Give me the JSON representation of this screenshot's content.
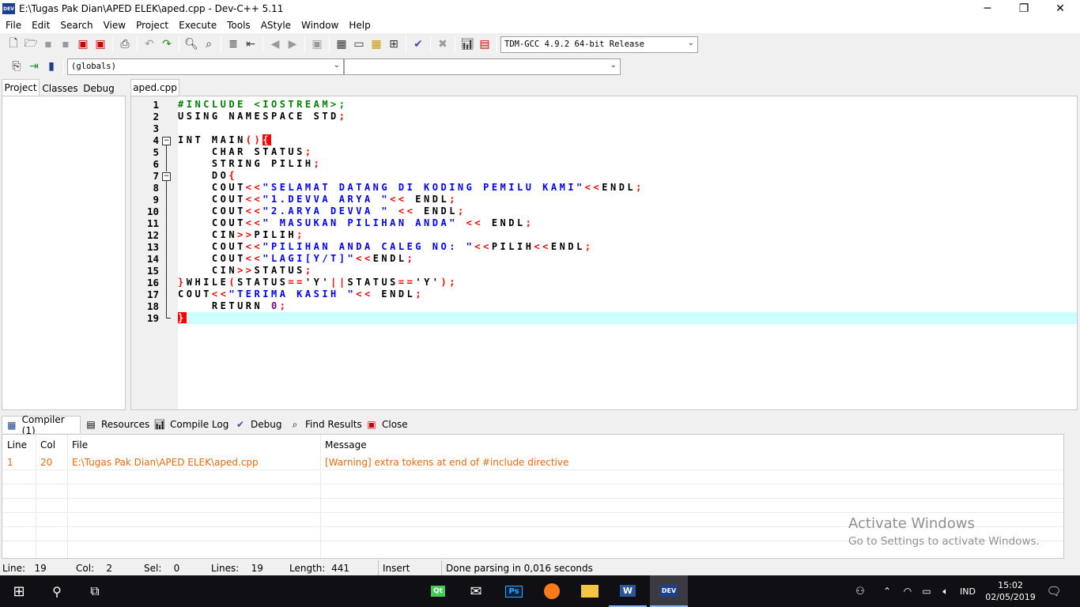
{
  "window": {
    "title": "E:\\Tugas Pak Dian\\APED ELEK\\aped.cpp - Dev-C++ 5.11",
    "app_icon_text": "DEV"
  },
  "menu": [
    "File",
    "Edit",
    "Search",
    "View",
    "Project",
    "Execute",
    "Tools",
    "AStyle",
    "Window",
    "Help"
  ],
  "toolbar": {
    "compiler_select": "TDM-GCC 4.9.2 64-bit Release",
    "scope_select": "(globals)",
    "function_select": ""
  },
  "left_tabs": [
    "Project",
    "Classes",
    "Debug"
  ],
  "editor": {
    "file_tab": "aped.cpp",
    "line_numbers": [
      "1",
      "2",
      "3",
      "4",
      "5",
      "6",
      "7",
      "8",
      "9",
      "10",
      "11",
      "12",
      "13",
      "14",
      "15",
      "16",
      "17",
      "18",
      "19"
    ],
    "fold_markers": {
      "line4": "−",
      "line7": "−"
    }
  },
  "code": {
    "l1": "#INCLUDE <IOSTREAM>;",
    "l2a": "USING NAMESPACE STD",
    "l2b": ";",
    "l4a": "INT MAIN",
    "l4b": "()",
    "l4c": "{",
    "l5a": "    CHAR STATUS",
    "l5b": ";",
    "l6a": "    STRING PILIH",
    "l6b": ";",
    "l7a": "    DO",
    "l7b": "{",
    "l8a": "    COUT",
    "l8b": "<<",
    "l8c": "\"SELAMAT DATANG DI KODING PEMILU KAMI\"",
    "l8d": "<<",
    "l8e": "ENDL",
    "l8f": ";",
    "l9a": "    COUT",
    "l9b": "<<",
    "l9c": "\"1.DEVVA ARYA \"",
    "l9d": "<<",
    "l9e": " ENDL",
    "l9f": ";",
    "l10a": "    COUT",
    "l10b": "<<",
    "l10c": "\"2.ARYA DEVVA \"",
    "l10d": " <<",
    "l10e": " ENDL",
    "l10f": ";",
    "l11a": "    COUT",
    "l11b": "<<",
    "l11c": "\" MASUKAN PILIHAN ANDA\"",
    "l11d": " <<",
    "l11e": " ENDL",
    "l11f": ";",
    "l12a": "    CIN",
    "l12b": ">>",
    "l12c": "PILIH",
    "l12d": ";",
    "l13a": "    COUT",
    "l13b": "<<",
    "l13c": "\"PILIHAN ANDA CALEG NO: \"",
    "l13d": "<<",
    "l13e": "PILIH",
    "l13f": "<<",
    "l13g": "ENDL",
    "l13h": ";",
    "l14a": "    COUT",
    "l14b": "<<",
    "l14c": "\"LAGI[Y/T]\"",
    "l14d": "<<",
    "l14e": "ENDL",
    "l14f": ";",
    "l15a": "    CIN",
    "l15b": ">>",
    "l15c": "STATUS",
    "l15d": ";",
    "l16a": "}",
    "l16b": "WHILE",
    "l16c": "(",
    "l16d": "STATUS",
    "l16e": "==",
    "l16f": "'Y'",
    "l16g": "||",
    "l16h": "STATUS",
    "l16i": "==",
    "l16j": "'Y'",
    "l16k": ");",
    "l17a": "COUT",
    "l17b": "<<",
    "l17c": "\"TERIMA KASIH \"",
    "l17d": "<<",
    "l17e": " ENDL",
    "l17f": ";",
    "l18a": "    RETURN ",
    "l18b": "0",
    "l18c": ";",
    "l19": "}"
  },
  "bottom_tabs": [
    "Compiler (1)",
    "Resources",
    "Compile Log",
    "Debug",
    "Find Results",
    "Close"
  ],
  "results": {
    "headers": [
      "Line",
      "Col",
      "File",
      "Message"
    ],
    "rows": [
      {
        "line": "1",
        "col": "20",
        "file": "E:\\Tugas Pak Dian\\APED ELEK\\aped.cpp",
        "message": "[Warning] extra tokens at end of #include directive"
      }
    ]
  },
  "status": {
    "line_label": "Line:",
    "line": "19",
    "col_label": "Col:",
    "col": "2",
    "sel_label": "Sel:",
    "sel": "0",
    "lines_label": "Lines:",
    "lines": "19",
    "length_label": "Length:",
    "length": "441",
    "mode": "Insert",
    "message": "Done parsing in 0,016 seconds"
  },
  "watermark": {
    "title": "Activate Windows",
    "subtitle": "Go to Settings to activate Windows."
  },
  "taskbar": {
    "lang": "IND",
    "time": "15:02",
    "date": "02/05/2019",
    "devcpp_icon_text": "DEV",
    "word_icon_text": "W",
    "ps_icon_text": "Ps",
    "qt_icon_text": "Qt"
  }
}
